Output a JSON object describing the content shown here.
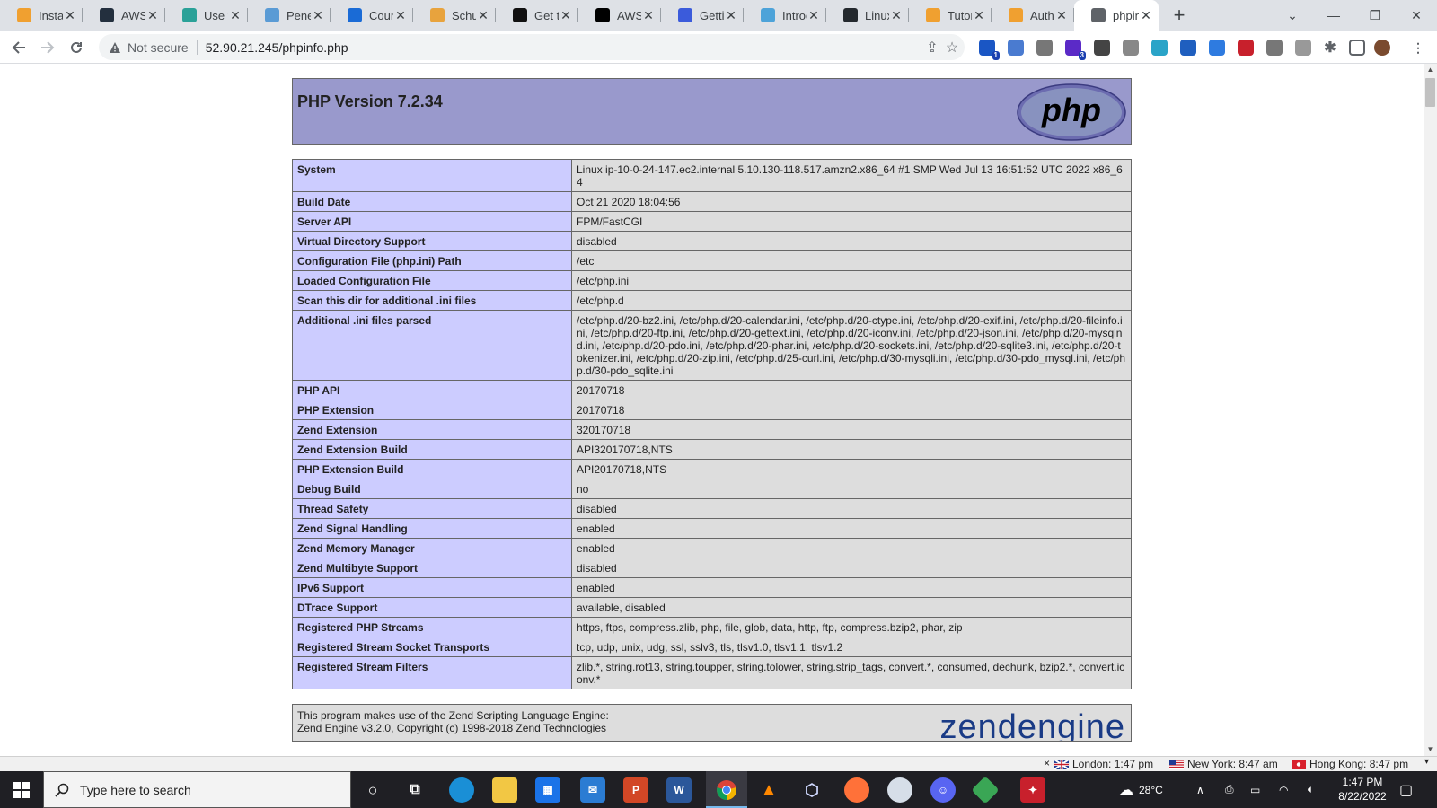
{
  "browser": {
    "tabs": [
      {
        "title": "Instan",
        "icon": "aws-box-icon",
        "color": "#f0a030"
      },
      {
        "title": "AWS C",
        "icon": "terminal-icon",
        "color": "#232f3e"
      },
      {
        "title": "Use th",
        "icon": "cloud-icon",
        "color": "#2aa198"
      },
      {
        "title": "Penet",
        "icon": "letter-n-icon",
        "color": "#5a9bd5"
      },
      {
        "title": "Cours",
        "icon": "coursera-icon",
        "color": "#1a6bd6"
      },
      {
        "title": "Schul",
        "icon": "hexagon-icon",
        "color": "#e8a33d"
      },
      {
        "title": "Get th",
        "icon": "chatbot-icon",
        "color": "#111111"
      },
      {
        "title": "AWS",
        "icon": "medium-icon",
        "color": "#000000"
      },
      {
        "title": "Gettin",
        "icon": "graduation-cap-icon",
        "color": "#3b5bdb"
      },
      {
        "title": "Introd",
        "icon": "cloud-icon",
        "color": "#4da3d9"
      },
      {
        "title": "Linux",
        "icon": "github-icon",
        "color": "#24292e"
      },
      {
        "title": "Tutor",
        "icon": "aws-box-icon",
        "color": "#f0a030"
      },
      {
        "title": "Autho",
        "icon": "aws-box-icon",
        "color": "#f0a030"
      },
      {
        "title": "phpin",
        "icon": "globe-icon",
        "color": "#5f6368"
      }
    ],
    "active_tab_index": 13,
    "address": {
      "security_label": "Not secure",
      "url": "52.90.21.245/phpinfo.php"
    },
    "extensions": [
      {
        "icon": "mail-extension-icon",
        "color": "#1a56c4",
        "badge": "1"
      },
      {
        "icon": "translate-extension-icon",
        "color": "#4a7bd0",
        "badge": ""
      },
      {
        "icon": "camera-extension-icon",
        "color": "#777777",
        "badge": ""
      },
      {
        "icon": "hex-extension-icon",
        "color": "#5b2ac7",
        "badge": "3"
      },
      {
        "icon": "building-extension-icon",
        "color": "#444444",
        "badge": ""
      },
      {
        "icon": "ip-extension-icon",
        "color": "#888888",
        "badge": ""
      },
      {
        "icon": "leaf-extension-icon",
        "color": "#2aa4c8",
        "badge": ""
      },
      {
        "icon": "shield-extension-icon",
        "color": "#1f5fbf",
        "badge": ""
      },
      {
        "icon": "chat-extension-icon",
        "color": "#2e7be0",
        "badge": ""
      },
      {
        "icon": "stop-extension-icon",
        "color": "#c8202c",
        "badge": ""
      },
      {
        "icon": "t-extension-icon",
        "color": "#777777",
        "badge": ""
      },
      {
        "icon": "link-extension-icon",
        "color": "#999999",
        "badge": ""
      }
    ]
  },
  "page": {
    "header_title": "PHP Version 7.2.34",
    "logo_text": "php",
    "rows": [
      {
        "key": "System",
        "value": "Linux ip-10-0-24-147.ec2.internal 5.10.130-118.517.amzn2.x86_64 #1 SMP Wed Jul 13 16:51:52 UTC 2022 x86_64"
      },
      {
        "key": "Build Date",
        "value": "Oct 21 2020 18:04:56"
      },
      {
        "key": "Server API",
        "value": "FPM/FastCGI"
      },
      {
        "key": "Virtual Directory Support",
        "value": "disabled"
      },
      {
        "key": "Configuration File (php.ini) Path",
        "value": "/etc"
      },
      {
        "key": "Loaded Configuration File",
        "value": "/etc/php.ini"
      },
      {
        "key": "Scan this dir for additional .ini files",
        "value": "/etc/php.d"
      },
      {
        "key": "Additional .ini files parsed",
        "value": "/etc/php.d/20-bz2.ini, /etc/php.d/20-calendar.ini, /etc/php.d/20-ctype.ini, /etc/php.d/20-exif.ini, /etc/php.d/20-fileinfo.ini, /etc/php.d/20-ftp.ini, /etc/php.d/20-gettext.ini, /etc/php.d/20-iconv.ini, /etc/php.d/20-json.ini, /etc/php.d/20-mysqlnd.ini, /etc/php.d/20-pdo.ini, /etc/php.d/20-phar.ini, /etc/php.d/20-sockets.ini, /etc/php.d/20-sqlite3.ini, /etc/php.d/20-tokenizer.ini, /etc/php.d/20-zip.ini, /etc/php.d/25-curl.ini, /etc/php.d/30-mysqli.ini, /etc/php.d/30-pdo_mysql.ini, /etc/php.d/30-pdo_sqlite.ini"
      },
      {
        "key": "PHP API",
        "value": "20170718"
      },
      {
        "key": "PHP Extension",
        "value": "20170718"
      },
      {
        "key": "Zend Extension",
        "value": "320170718"
      },
      {
        "key": "Zend Extension Build",
        "value": "API320170718,NTS"
      },
      {
        "key": "PHP Extension Build",
        "value": "API20170718,NTS"
      },
      {
        "key": "Debug Build",
        "value": "no"
      },
      {
        "key": "Thread Safety",
        "value": "disabled"
      },
      {
        "key": "Zend Signal Handling",
        "value": "enabled"
      },
      {
        "key": "Zend Memory Manager",
        "value": "enabled"
      },
      {
        "key": "Zend Multibyte Support",
        "value": "disabled"
      },
      {
        "key": "IPv6 Support",
        "value": "enabled"
      },
      {
        "key": "DTrace Support",
        "value": "available, disabled"
      },
      {
        "key": "Registered PHP Streams",
        "value": "https, ftps, compress.zlib, php, file, glob, data, http, ftp, compress.bzip2, phar, zip"
      },
      {
        "key": "Registered Stream Socket Transports",
        "value": "tcp, udp, unix, udg, ssl, sslv3, tls, tlsv1.0, tlsv1.1, tlsv1.2"
      },
      {
        "key": "Registered Stream Filters",
        "value": "zlib.*, string.rot13, string.toupper, string.tolower, string.strip_tags, convert.*, consumed, dechunk, bzip2.*, convert.iconv.*"
      }
    ],
    "zend": {
      "line1": "This program makes use of the Zend Scripting Language Engine:",
      "line2": "Zend Engine v3.2.0, Copyright (c) 1998-2018 Zend Technologies",
      "logo_text": "zendengine"
    }
  },
  "clocks": [
    {
      "label": "London: 1:47 pm",
      "flag": "uk"
    },
    {
      "label": "New York: 8:47 am",
      "flag": "us"
    },
    {
      "label": "Hong Kong: 8:47 pm",
      "flag": "hk"
    }
  ],
  "taskbar": {
    "search_placeholder": "Type here to search",
    "weather": "28°C",
    "time": "1:47 PM",
    "date": "8/22/2022"
  },
  "colors": {
    "php_header": "#9999cc",
    "php_key_cell": "#ccccff",
    "php_value_cell": "#dddddd"
  }
}
